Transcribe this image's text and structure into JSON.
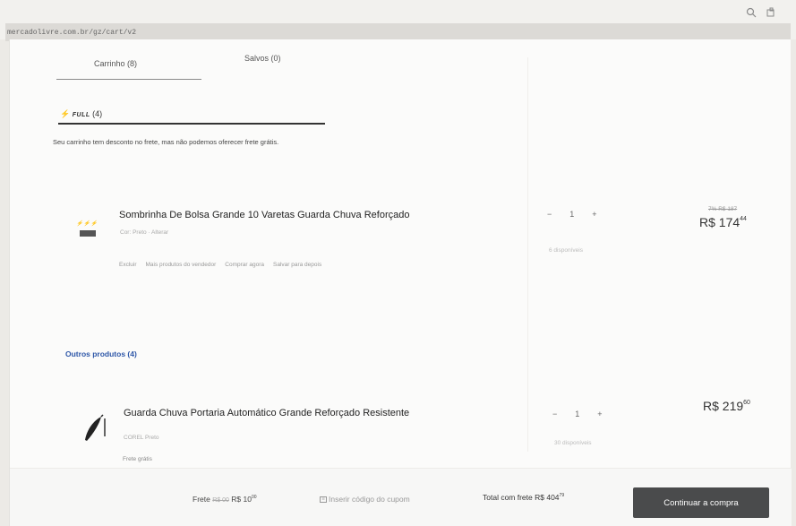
{
  "browser": {
    "url": "mercadolivre.com.br/gz/cart/v2",
    "search_icon": "search-icon",
    "extension_icon": "puzzle-icon"
  },
  "tabs": [
    {
      "label": "Carrinho (8)",
      "active": true
    },
    {
      "label": "Salvos (0)",
      "active": false
    }
  ],
  "full_section": {
    "badge": "FULL",
    "count": "(4)",
    "notice": "Seu carrinho tem desconto no frete, mas não podemos oferecer frete grátis."
  },
  "items": [
    {
      "title": "Sombrinha De Bolsa Grande 10 Varetas Guarda Chuva Reforçado",
      "meta": "Cor: Preto · Alterar",
      "actions": [
        "Excluir",
        "Mais produtos do vendedor",
        "Comprar agora",
        "Salvar para depois"
      ],
      "quantity": "1",
      "availability": "6 disponíveis",
      "old_price": "7% R$ 187",
      "price_main": "R$ 174",
      "price_cents": "44"
    },
    {
      "title": "Guarda Chuva Portaria Automático Grande Reforçado Resistente",
      "meta": "COREL Preto",
      "free_shipping": "Frete grátis",
      "quantity": "1",
      "availability": "30 disponíveis",
      "price_main": "R$ 219",
      "price_cents": "60"
    }
  ],
  "others_label": "Outros produtos (4)",
  "footer": {
    "frete_label": "Frete",
    "frete_old": "R$ 00",
    "frete_new": "R$ 10",
    "frete_new_cents": "00",
    "coupon_label": "Inserir código do cupom",
    "total_label": "Total com frete",
    "total_value": "R$ 404",
    "total_cents": "79",
    "continue_label": "Continuar a compra"
  },
  "colors": {
    "accent_link": "#2e57a8",
    "cta_bg": "#4a4b4c"
  }
}
